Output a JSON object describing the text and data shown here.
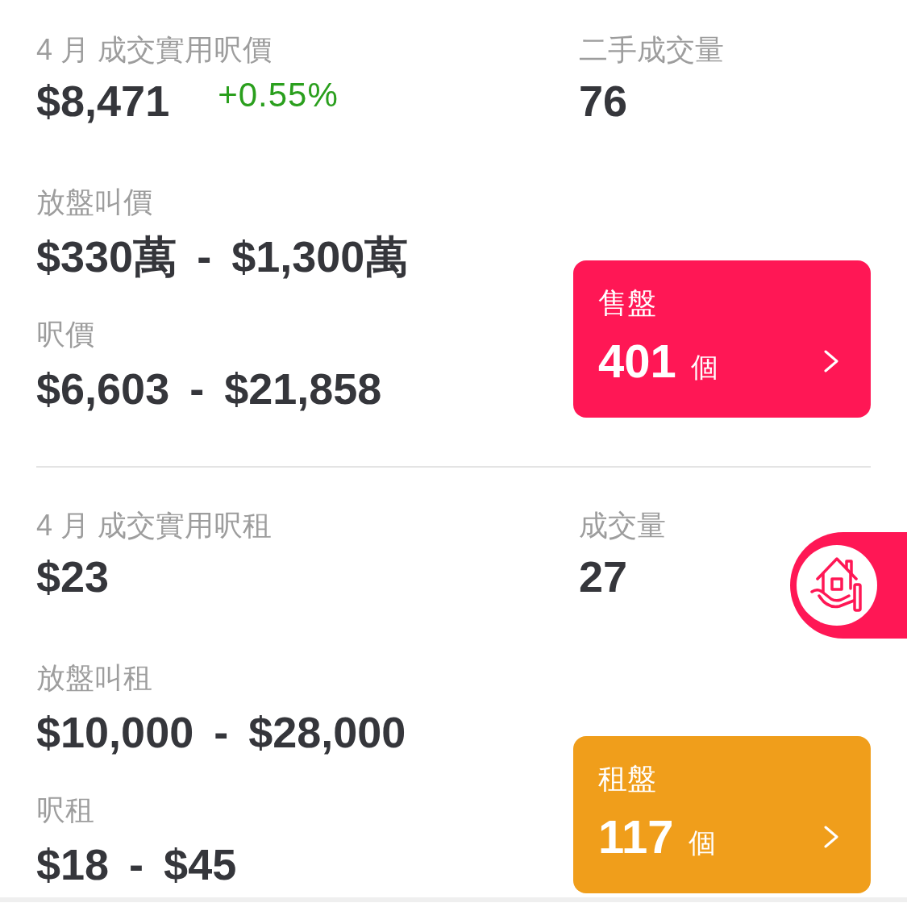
{
  "sections": [
    {
      "price": {
        "label": "4 月 成交實用呎價",
        "value": "$8,471",
        "change": {
          "text": "+0.55%",
          "rising": true
        }
      },
      "volume": {
        "label": "二手成交量",
        "value": "76"
      },
      "ranges": [
        {
          "label": "放盤叫價",
          "low": "$330萬",
          "separator": "-",
          "high": "$1,300萬"
        },
        {
          "label": "呎價",
          "low": "$6,603",
          "separator": "-",
          "high": "$21,858"
        }
      ],
      "card": {
        "title": "售盤",
        "count": "401",
        "unit": "個",
        "color": "#ff1755"
      }
    },
    {
      "price": {
        "label": "4 月 成交實用呎租",
        "value": "$23"
      },
      "volume": {
        "label": "成交量",
        "value": "27"
      },
      "ranges": [
        {
          "label": "放盤叫租",
          "low": "$10,000",
          "separator": "-",
          "high": "$28,000"
        },
        {
          "label": "呎租",
          "low": "$18",
          "separator": "-",
          "high": "$45"
        }
      ],
      "card": {
        "title": "租盤",
        "count": "117",
        "unit": "個",
        "color": "#f09e1b"
      }
    }
  ]
}
